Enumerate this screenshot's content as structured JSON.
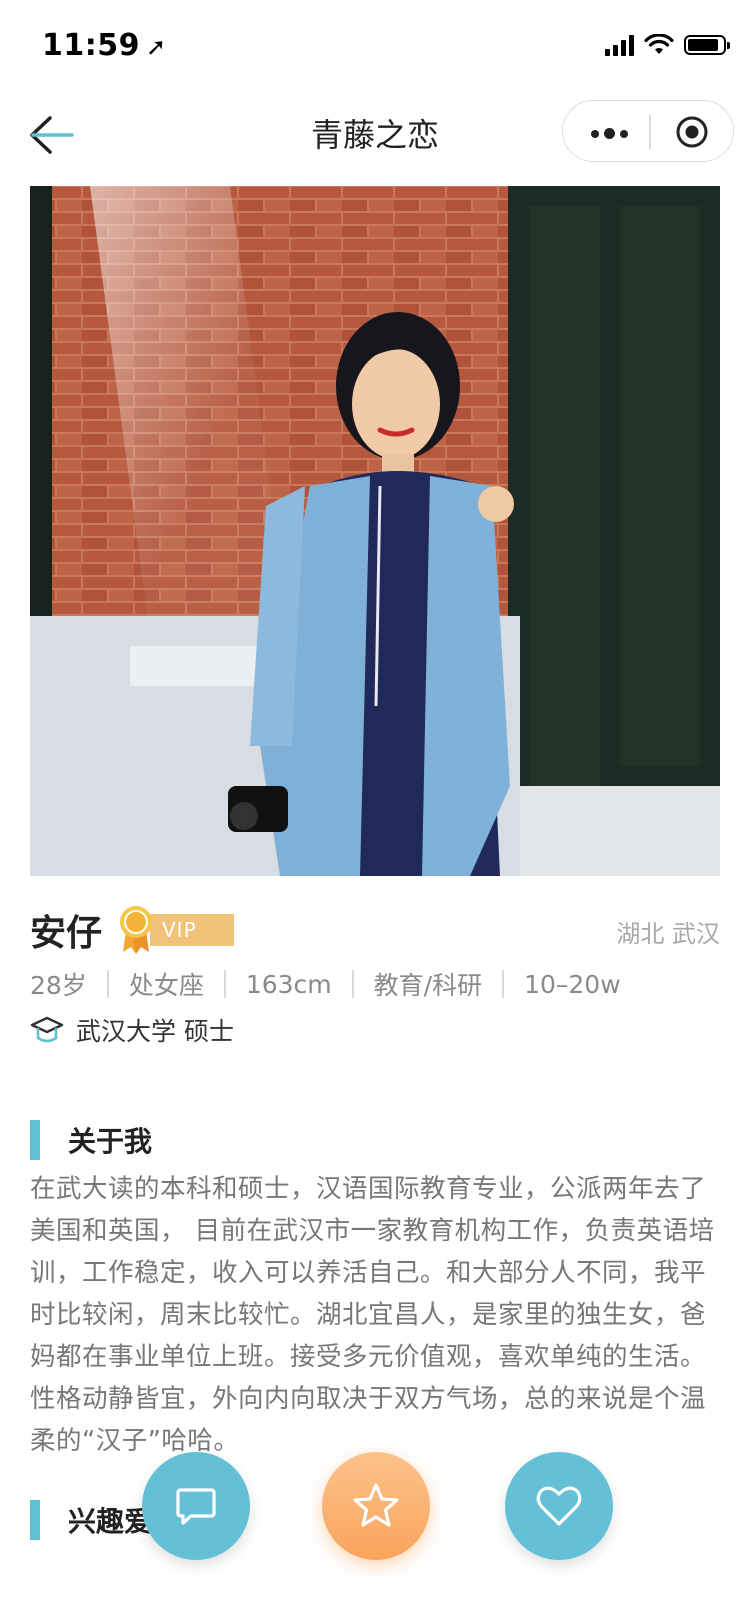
{
  "status": {
    "time": "11:59"
  },
  "nav": {
    "title": "青藤之恋"
  },
  "profile": {
    "name": "安仔",
    "vip_label": "VIP",
    "location": "湖北  武汉",
    "age": "28岁",
    "zodiac": "处女座",
    "height": "163cm",
    "industry": "教育/科研",
    "income": "10–20w",
    "education": "武汉大学  硕士"
  },
  "about": {
    "title": "关于我",
    "text": "在武大读的本科和硕士，汉语国际教育专业，公派两年去了美国和英国， 目前在武汉市一家教育机构工作，负责英语培训，工作稳定，收入可以养活自己。和大部分人不同，我平时比较闲，周末比较忙。湖北宜昌人，是家里的独生女，爸妈都在事业单位上班。接受多元价值观，喜欢单纯的生活。性格动静皆宜，外向内向取决于双方气场，总的来说是个温柔的“汉子”哈哈。"
  },
  "hobby": {
    "title": "兴趣爱"
  },
  "actions": {
    "chat_icon": "chat-bubble-icon",
    "star_icon": "star-icon",
    "heart_icon": "heart-icon"
  },
  "colors": {
    "accent": "#63c0d6",
    "star_orange": "#f9a45c",
    "vip_gold": "#f1c27a"
  }
}
